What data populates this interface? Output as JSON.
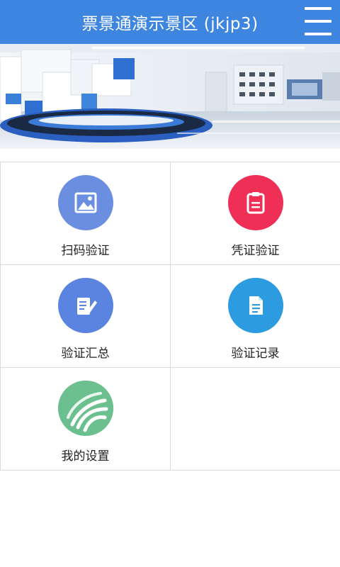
{
  "header": {
    "title": "票景通演示景区 (jkjp3)",
    "menu_icon": "hamburger-icon"
  },
  "banner": {
    "description_icon": "exhibition-hall-photo"
  },
  "menu": [
    {
      "label": "扫码验证",
      "icon": "image-icon",
      "color": "#6a8fe0"
    },
    {
      "label": "凭证验证",
      "icon": "clipboard-icon",
      "color": "#ef2f56"
    },
    {
      "label": "验证汇总",
      "icon": "edit-note-icon",
      "color": "#5b84e0"
    },
    {
      "label": "验证记录",
      "icon": "document-icon",
      "color": "#2d9be0"
    },
    {
      "label": "我的设置",
      "icon": "wave-logo-icon",
      "color": "#6cc08f"
    }
  ]
}
